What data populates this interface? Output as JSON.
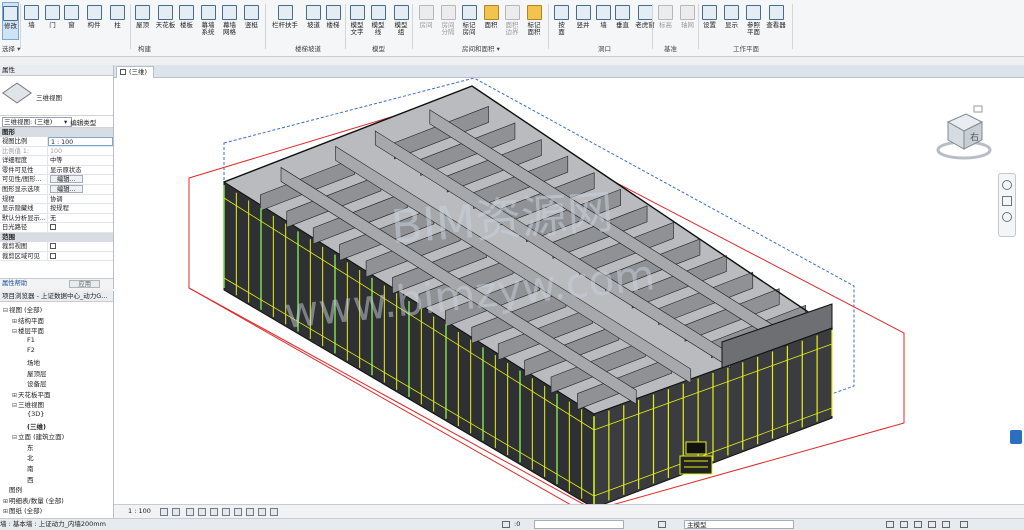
{
  "ribbon": {
    "buttons": [
      {
        "label": "修改",
        "icon": "modify-arrow-icon"
      },
      {
        "label": "墙",
        "icon": "wall-icon"
      },
      {
        "label": "门",
        "icon": "door-icon"
      },
      {
        "label": "窗",
        "icon": "window-icon"
      },
      {
        "label": "构件",
        "icon": "component-icon"
      },
      {
        "label": "柱",
        "icon": "column-icon"
      },
      {
        "label": "屋顶",
        "icon": "roof-icon"
      },
      {
        "label": "天花板",
        "icon": "ceiling-icon"
      },
      {
        "label": "楼板",
        "icon": "floor-icon"
      },
      {
        "label": "幕墙\n系统",
        "icon": "curtain-system-icon"
      },
      {
        "label": "幕墙\n网格",
        "icon": "curtain-grid-icon"
      },
      {
        "label": "竖梃",
        "icon": "mullion-icon"
      },
      {
        "label": "栏杆扶手",
        "icon": "railing-icon"
      },
      {
        "label": "坡道",
        "icon": "ramp-icon"
      },
      {
        "label": "楼梯",
        "icon": "stair-icon"
      },
      {
        "label": "模型\n文字",
        "icon": "model-text-icon"
      },
      {
        "label": "模型\n线",
        "icon": "model-line-icon"
      },
      {
        "label": "模型\n组",
        "icon": "model-group-icon"
      },
      {
        "label": "房间",
        "icon": "room-icon"
      },
      {
        "label": "房间\n分隔",
        "icon": "room-separator-icon"
      },
      {
        "label": "标记\n房间",
        "icon": "tag-room-icon"
      },
      {
        "label": "面积",
        "icon": "area-icon"
      },
      {
        "label": "面积\n边界",
        "icon": "area-boundary-icon"
      },
      {
        "label": "标记\n面积",
        "icon": "tag-area-icon"
      },
      {
        "label": "按\n面",
        "icon": "by-face-icon"
      },
      {
        "label": "竖井",
        "icon": "shaft-icon"
      },
      {
        "label": "墙",
        "icon": "opening-wall-icon"
      },
      {
        "label": "垂直",
        "icon": "vertical-opening-icon"
      },
      {
        "label": "老虎窗",
        "icon": "dormer-icon"
      },
      {
        "label": "标高",
        "icon": "level-icon"
      },
      {
        "label": "轴网",
        "icon": "grid-icon"
      },
      {
        "label": "设置",
        "icon": "set-workplane-icon"
      },
      {
        "label": "显示",
        "icon": "show-workplane-icon"
      },
      {
        "label": "参照\n平面",
        "icon": "ref-plane-icon"
      },
      {
        "label": "查看器",
        "icon": "viewer-icon"
      }
    ],
    "panels": [
      "选择 ▾",
      "构建",
      "楼梯坡道",
      "模型",
      "房间和面积 ▾",
      "洞口",
      "基准",
      "工作平面"
    ]
  },
  "properties": {
    "title": "属性",
    "type_name": "三维视图",
    "view_selector": "三维视图: (三维)",
    "edit_type": "编辑类型",
    "sections": {
      "graphics": "图形",
      "range": "范围"
    },
    "rows": [
      {
        "k": "视图比例",
        "v": "1 : 100"
      },
      {
        "k": "比例值 1:",
        "v": "100"
      },
      {
        "k": "详细程度",
        "v": "中等"
      },
      {
        "k": "零件可见性",
        "v": "显示原状态"
      },
      {
        "k": "可见性/图形...",
        "v": "编辑..."
      },
      {
        "k": "图形显示选项",
        "v": "编辑..."
      },
      {
        "k": "规程",
        "v": "协调"
      },
      {
        "k": "显示隐藏线",
        "v": "按规程"
      },
      {
        "k": "默认分析显示...",
        "v": "无"
      },
      {
        "k": "日光路径",
        "v": ""
      }
    ],
    "range_rows": [
      {
        "k": "裁剪视图",
        "v": ""
      },
      {
        "k": "裁剪区域可见",
        "v": ""
      }
    ],
    "help_link": "属性帮助",
    "apply": "应用"
  },
  "browser": {
    "title": "项目浏览器 - 上证数据中心_动力G...",
    "items": [
      {
        "label": "视图 (全部)",
        "level": 0,
        "toggle": "−"
      },
      {
        "label": "结构平面",
        "level": 1,
        "toggle": "+"
      },
      {
        "label": "楼层平面",
        "level": 1,
        "toggle": "−"
      },
      {
        "label": "F1",
        "level": 2,
        "toggle": ""
      },
      {
        "label": "F2",
        "level": 2,
        "toggle": ""
      },
      {
        "label": "场地",
        "level": 2,
        "toggle": ""
      },
      {
        "label": "屋顶层",
        "level": 2,
        "toggle": ""
      },
      {
        "label": "设备层",
        "level": 2,
        "toggle": ""
      },
      {
        "label": "天花板平面",
        "level": 1,
        "toggle": "+"
      },
      {
        "label": "三维视图",
        "level": 1,
        "toggle": "−"
      },
      {
        "label": "{3D}",
        "level": 2,
        "toggle": ""
      },
      {
        "label": "(三维)",
        "level": 2,
        "toggle": ""
      },
      {
        "label": "立面 (建筑立面)",
        "level": 1,
        "toggle": "−"
      },
      {
        "label": "东",
        "level": 2,
        "toggle": ""
      },
      {
        "label": "北",
        "level": 2,
        "toggle": ""
      },
      {
        "label": "南",
        "level": 2,
        "toggle": ""
      },
      {
        "label": "西",
        "level": 2,
        "toggle": ""
      },
      {
        "label": "图例",
        "level": 0,
        "toggle": ""
      },
      {
        "label": "明细表/数量 (全部)",
        "level": 0,
        "toggle": "+"
      },
      {
        "label": "图纸 (全部)",
        "level": 0,
        "toggle": "+"
      }
    ]
  },
  "view": {
    "tab_label": "(三维)",
    "watermark": "BIM资源网",
    "watermark_url": "www.bimzyw.com",
    "viewcube_face": "右"
  },
  "viewbar": {
    "scale": "1 : 100"
  },
  "status": {
    "text": "墙 : 基本墙 : 上证动力_内墙200mm",
    "ws_value": ":0",
    "model": "主模型"
  },
  "colors": {
    "accent": "#2b6fbf",
    "crop_red": "#e0282a",
    "section_blue": "#3a6bd6",
    "highlight_yellow": "#e6f015"
  }
}
